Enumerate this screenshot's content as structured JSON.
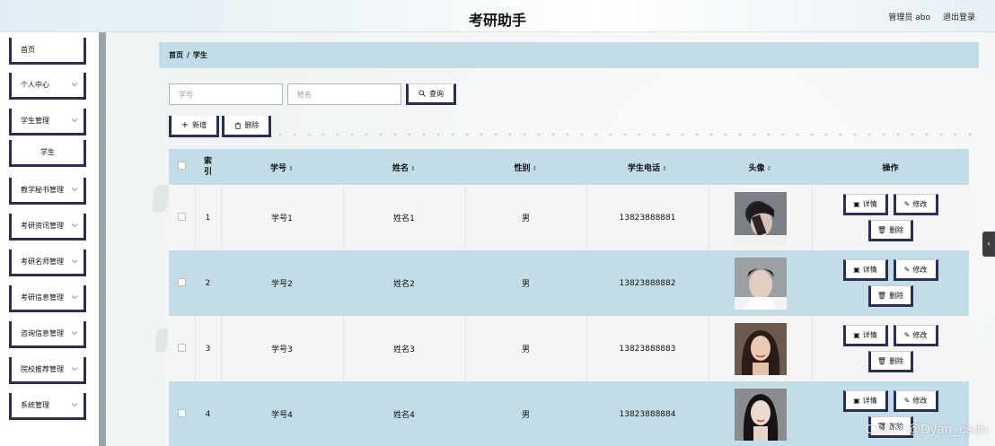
{
  "header": {
    "title": "考研助手",
    "user": "管理员 abo",
    "logout": "退出登录"
  },
  "sidebar": {
    "items": [
      {
        "label": "首页",
        "chevron": false
      },
      {
        "label": "个人中心",
        "chevron": true
      },
      {
        "label": "学生管理",
        "chevron": true
      },
      {
        "label": "学生",
        "chevron": false,
        "sub": true
      },
      {
        "label": "教学秘书管理",
        "chevron": true
      },
      {
        "label": "考研资讯管理",
        "chevron": true
      },
      {
        "label": "考研名师管理",
        "chevron": true
      },
      {
        "label": "考研信息管理",
        "chevron": true
      },
      {
        "label": "咨询信息管理",
        "chevron": true
      },
      {
        "label": "院校推荐管理",
        "chevron": true
      },
      {
        "label": "系统管理",
        "chevron": true
      }
    ]
  },
  "breadcrumb": {
    "home": "首页",
    "sep": "/",
    "current": "学生"
  },
  "search": {
    "student_no_placeholder": "学号",
    "name_placeholder": "姓名",
    "query_label": "查询"
  },
  "toolbar": {
    "add_label": "新增",
    "delete_label": "删除"
  },
  "table": {
    "headers": {
      "index": "索引",
      "student_no": "学号",
      "name": "姓名",
      "gender": "性别",
      "phone": "学生电话",
      "avatar": "头像",
      "actions": "操作"
    },
    "rows": [
      {
        "index": "1",
        "student_no": "学号1",
        "name": "姓名1",
        "gender": "男",
        "phone": "13823888881"
      },
      {
        "index": "2",
        "student_no": "学号2",
        "name": "姓名2",
        "gender": "男",
        "phone": "13823888882"
      },
      {
        "index": "3",
        "student_no": "学号3",
        "name": "姓名3",
        "gender": "男",
        "phone": "13823888883"
      },
      {
        "index": "4",
        "student_no": "学号4",
        "name": "姓名4",
        "gender": "男",
        "phone": "13823888884"
      }
    ],
    "action_labels": {
      "detail": "详情",
      "edit": "修改",
      "delete": "删除"
    }
  },
  "watermark": "CSDN @Dyan_csdn",
  "colors": {
    "accent_border": "#2a2f55",
    "header_blue": "#c2dde8"
  }
}
